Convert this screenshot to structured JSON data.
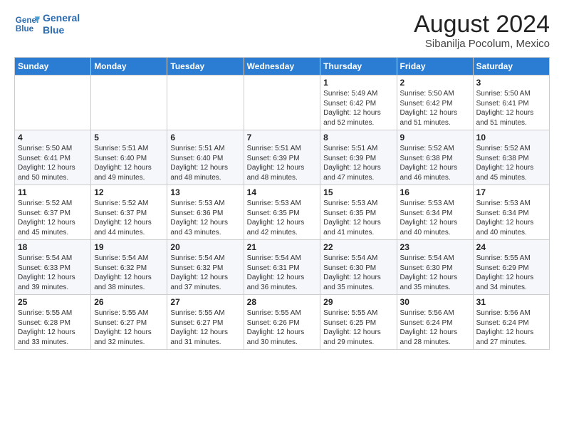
{
  "logo": {
    "line1": "General",
    "line2": "Blue"
  },
  "title": "August 2024",
  "subtitle": "Sibanilja Pocolum, Mexico",
  "days_of_week": [
    "Sunday",
    "Monday",
    "Tuesday",
    "Wednesday",
    "Thursday",
    "Friday",
    "Saturday"
  ],
  "weeks": [
    [
      {
        "day": "",
        "info": ""
      },
      {
        "day": "",
        "info": ""
      },
      {
        "day": "",
        "info": ""
      },
      {
        "day": "",
        "info": ""
      },
      {
        "day": "1",
        "info": "Sunrise: 5:49 AM\nSunset: 6:42 PM\nDaylight: 12 hours\nand 52 minutes."
      },
      {
        "day": "2",
        "info": "Sunrise: 5:50 AM\nSunset: 6:42 PM\nDaylight: 12 hours\nand 51 minutes."
      },
      {
        "day": "3",
        "info": "Sunrise: 5:50 AM\nSunset: 6:41 PM\nDaylight: 12 hours\nand 51 minutes."
      }
    ],
    [
      {
        "day": "4",
        "info": "Sunrise: 5:50 AM\nSunset: 6:41 PM\nDaylight: 12 hours\nand 50 minutes."
      },
      {
        "day": "5",
        "info": "Sunrise: 5:51 AM\nSunset: 6:40 PM\nDaylight: 12 hours\nand 49 minutes."
      },
      {
        "day": "6",
        "info": "Sunrise: 5:51 AM\nSunset: 6:40 PM\nDaylight: 12 hours\nand 48 minutes."
      },
      {
        "day": "7",
        "info": "Sunrise: 5:51 AM\nSunset: 6:39 PM\nDaylight: 12 hours\nand 48 minutes."
      },
      {
        "day": "8",
        "info": "Sunrise: 5:51 AM\nSunset: 6:39 PM\nDaylight: 12 hours\nand 47 minutes."
      },
      {
        "day": "9",
        "info": "Sunrise: 5:52 AM\nSunset: 6:38 PM\nDaylight: 12 hours\nand 46 minutes."
      },
      {
        "day": "10",
        "info": "Sunrise: 5:52 AM\nSunset: 6:38 PM\nDaylight: 12 hours\nand 45 minutes."
      }
    ],
    [
      {
        "day": "11",
        "info": "Sunrise: 5:52 AM\nSunset: 6:37 PM\nDaylight: 12 hours\nand 45 minutes."
      },
      {
        "day": "12",
        "info": "Sunrise: 5:52 AM\nSunset: 6:37 PM\nDaylight: 12 hours\nand 44 minutes."
      },
      {
        "day": "13",
        "info": "Sunrise: 5:53 AM\nSunset: 6:36 PM\nDaylight: 12 hours\nand 43 minutes."
      },
      {
        "day": "14",
        "info": "Sunrise: 5:53 AM\nSunset: 6:35 PM\nDaylight: 12 hours\nand 42 minutes."
      },
      {
        "day": "15",
        "info": "Sunrise: 5:53 AM\nSunset: 6:35 PM\nDaylight: 12 hours\nand 41 minutes."
      },
      {
        "day": "16",
        "info": "Sunrise: 5:53 AM\nSunset: 6:34 PM\nDaylight: 12 hours\nand 40 minutes."
      },
      {
        "day": "17",
        "info": "Sunrise: 5:53 AM\nSunset: 6:34 PM\nDaylight: 12 hours\nand 40 minutes."
      }
    ],
    [
      {
        "day": "18",
        "info": "Sunrise: 5:54 AM\nSunset: 6:33 PM\nDaylight: 12 hours\nand 39 minutes."
      },
      {
        "day": "19",
        "info": "Sunrise: 5:54 AM\nSunset: 6:32 PM\nDaylight: 12 hours\nand 38 minutes."
      },
      {
        "day": "20",
        "info": "Sunrise: 5:54 AM\nSunset: 6:32 PM\nDaylight: 12 hours\nand 37 minutes."
      },
      {
        "day": "21",
        "info": "Sunrise: 5:54 AM\nSunset: 6:31 PM\nDaylight: 12 hours\nand 36 minutes."
      },
      {
        "day": "22",
        "info": "Sunrise: 5:54 AM\nSunset: 6:30 PM\nDaylight: 12 hours\nand 35 minutes."
      },
      {
        "day": "23",
        "info": "Sunrise: 5:54 AM\nSunset: 6:30 PM\nDaylight: 12 hours\nand 35 minutes."
      },
      {
        "day": "24",
        "info": "Sunrise: 5:55 AM\nSunset: 6:29 PM\nDaylight: 12 hours\nand 34 minutes."
      }
    ],
    [
      {
        "day": "25",
        "info": "Sunrise: 5:55 AM\nSunset: 6:28 PM\nDaylight: 12 hours\nand 33 minutes."
      },
      {
        "day": "26",
        "info": "Sunrise: 5:55 AM\nSunset: 6:27 PM\nDaylight: 12 hours\nand 32 minutes."
      },
      {
        "day": "27",
        "info": "Sunrise: 5:55 AM\nSunset: 6:27 PM\nDaylight: 12 hours\nand 31 minutes."
      },
      {
        "day": "28",
        "info": "Sunrise: 5:55 AM\nSunset: 6:26 PM\nDaylight: 12 hours\nand 30 minutes."
      },
      {
        "day": "29",
        "info": "Sunrise: 5:55 AM\nSunset: 6:25 PM\nDaylight: 12 hours\nand 29 minutes."
      },
      {
        "day": "30",
        "info": "Sunrise: 5:56 AM\nSunset: 6:24 PM\nDaylight: 12 hours\nand 28 minutes."
      },
      {
        "day": "31",
        "info": "Sunrise: 5:56 AM\nSunset: 6:24 PM\nDaylight: 12 hours\nand 27 minutes."
      }
    ]
  ]
}
